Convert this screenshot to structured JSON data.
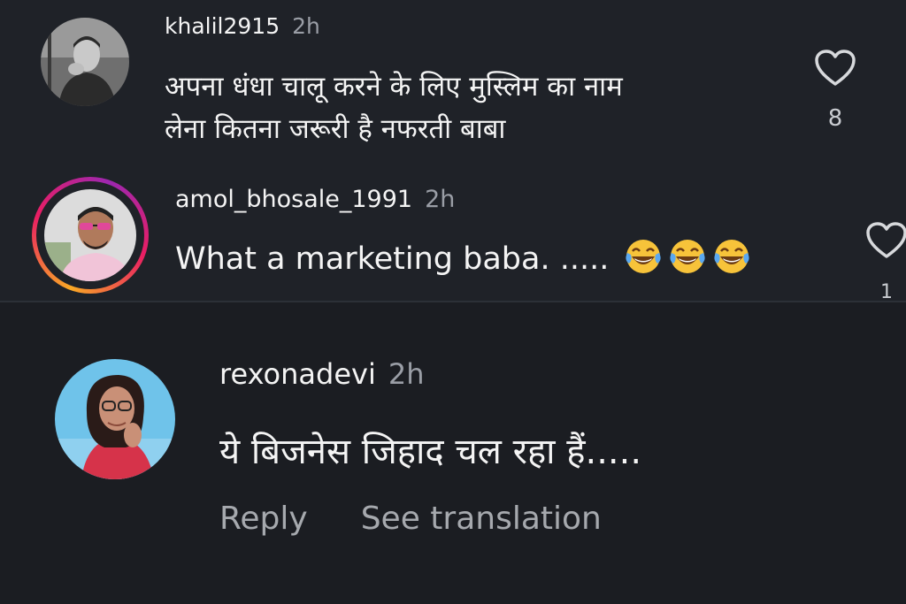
{
  "comments": [
    {
      "username": "khalil2915",
      "time": "2h",
      "text_line1": "अपना धंधा चालू करने के लिए मुस्लिम का नाम",
      "text_line2": "लेना कितना जरूरी है नफरती बाबा",
      "likes": "8",
      "icon": "heart-outline-icon"
    },
    {
      "username": "amol_bhosale_1991",
      "time": "2h",
      "text": "What a marketing baba. .....",
      "emoji": [
        "face-with-tears-of-joy",
        "face-with-tears-of-joy",
        "face-with-tears-of-joy"
      ],
      "likes": "1",
      "icon": "heart-outline-icon",
      "story_ring_colors": [
        "#f9a825",
        "#e91e63",
        "#9c27b0"
      ]
    },
    {
      "username": "rexonadevi",
      "time": "2h",
      "text": "ये बिजनेस जिहाद चल रहा हैं.....",
      "actions": {
        "reply": "Reply",
        "see_translation": "See translation"
      }
    }
  ],
  "colors": {
    "background": "#1f2228",
    "background_lower": "#1b1d22",
    "text": "#f4f4f4",
    "muted": "#9a9ea6"
  }
}
